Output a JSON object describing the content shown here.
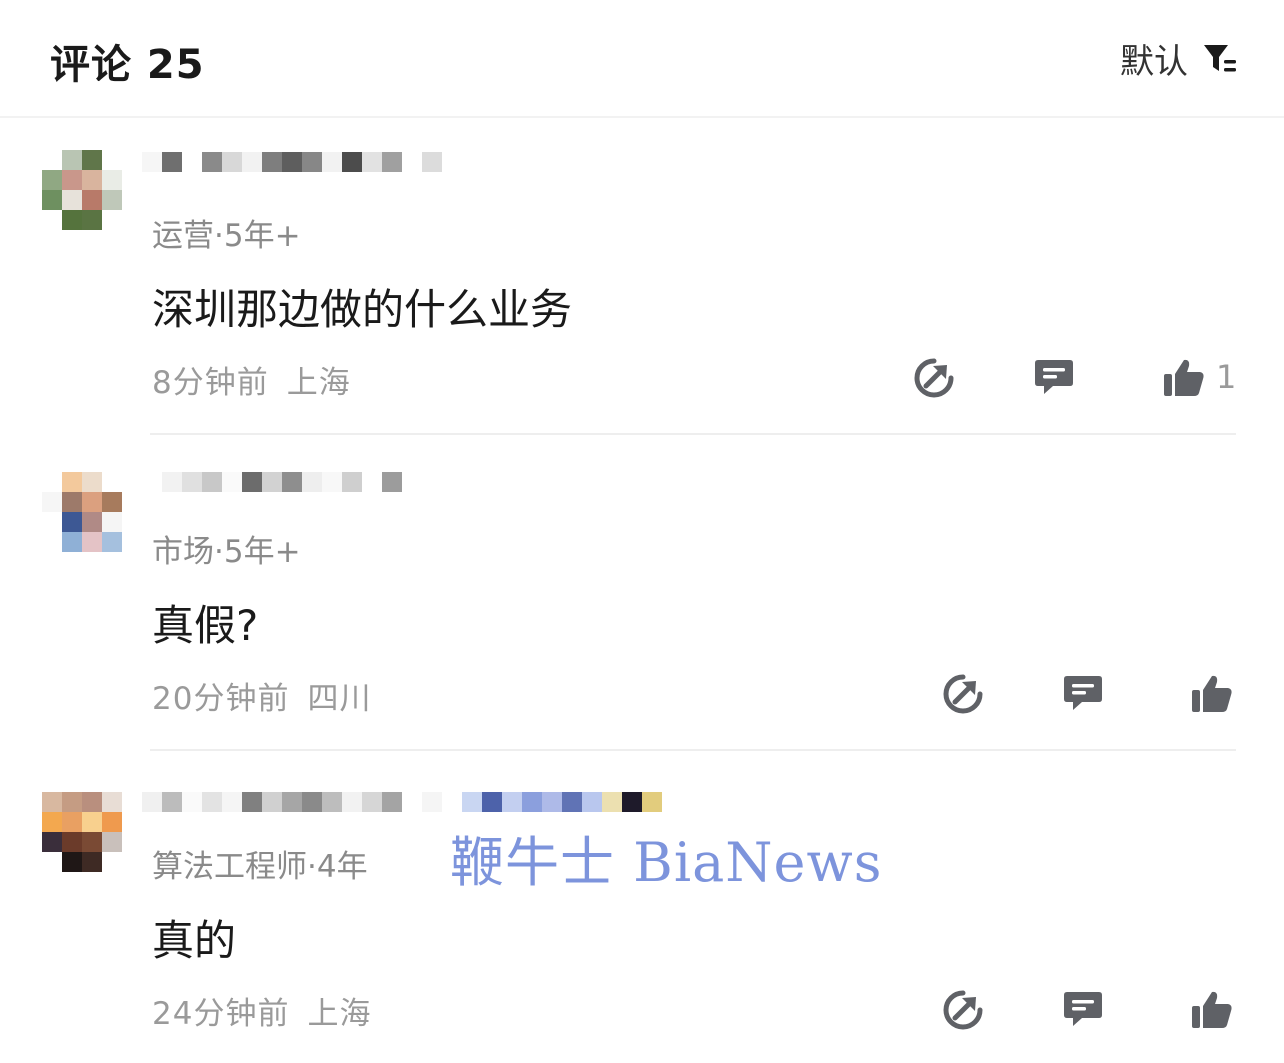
{
  "header": {
    "title": "评论 25",
    "sort_label": "默认"
  },
  "comments": [
    {
      "role": "运营·5年+",
      "text": "深圳那边做的什么业务",
      "time": "8分钟前",
      "location": "上海",
      "likes": "1"
    },
    {
      "role": "市场·5年+",
      "text": "真假?",
      "time": "20分钟前",
      "location": "四川",
      "likes": ""
    },
    {
      "role": "算法工程师·4年",
      "text": "真的",
      "time": "24分钟前",
      "location": "上海",
      "likes": ""
    }
  ],
  "watermark": "鞭牛士 BiaNews",
  "icons": {
    "sort": "filter-icon",
    "share": "share-icon",
    "reply": "comment-icon",
    "like": "thumbs-up-icon"
  },
  "colors": {
    "icon": "#5f6166",
    "secondary_text": "#9a9a9a",
    "watermark": "#6c86d8"
  }
}
